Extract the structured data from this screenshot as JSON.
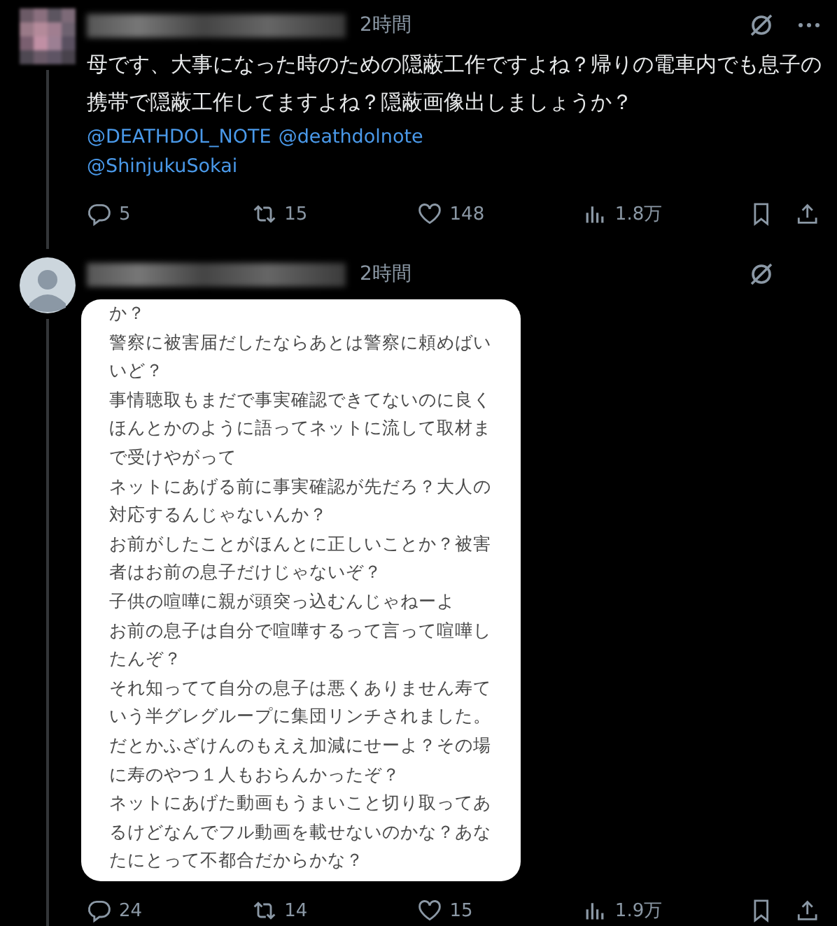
{
  "posts": [
    {
      "avatar": {
        "kind": "pixelated"
      },
      "time": "2時間",
      "text": "母です、大事になった時のための隠蔽工作ですよね？帰りの電車内でも息子の携帯で隠蔽工作してますよね？隠蔽画像出しましょうか？",
      "mentions": [
        "@DEATHDOL_NOTE",
        "@deathdolnote",
        "@ShinjukuSokai"
      ],
      "more_menu": true,
      "stats": {
        "replies": "5",
        "reposts": "15",
        "likes": "148",
        "views": "1.8万"
      }
    },
    {
      "avatar": {
        "kind": "default"
      },
      "time": "2時間",
      "more_menu": false,
      "image_lines": [
        "か？",
        "警察に被害届だしたならあとは警察に頼めばい",
        "いど？",
        "事情聴取もまだで事実確認できてないのに良く",
        "ほんとかのように語ってネットに流して取材ま",
        "で受けやがって",
        "ネットにあげる前に事実確認が先だろ？大人の",
        "対応するんじゃないんか？",
        "お前がしたことがほんとに正しいことか？被害",
        "者はお前の息子だけじゃないぞ？",
        "子供の喧嘩に親が頭突っ込むんじゃねーよ",
        "お前の息子は自分で喧嘩するって言って喧嘩し",
        "たんぞ？",
        "それ知ってて自分の息子は悪くありません寿て",
        "いう半グレグループに集団リンチされました。",
        "だとかふざけんのもええ加減にせーよ？その場",
        "に寿のやつ１人もおらんかったぞ？",
        "ネットにあげた動画もうまいこと切り取ってあ",
        "るけどなんでフル動画を載せないのかな？あな",
        "たにとって不都合だからかな？"
      ],
      "stats": {
        "replies": "24",
        "reposts": "14",
        "likes": "15",
        "views": "1.9万"
      }
    }
  ]
}
